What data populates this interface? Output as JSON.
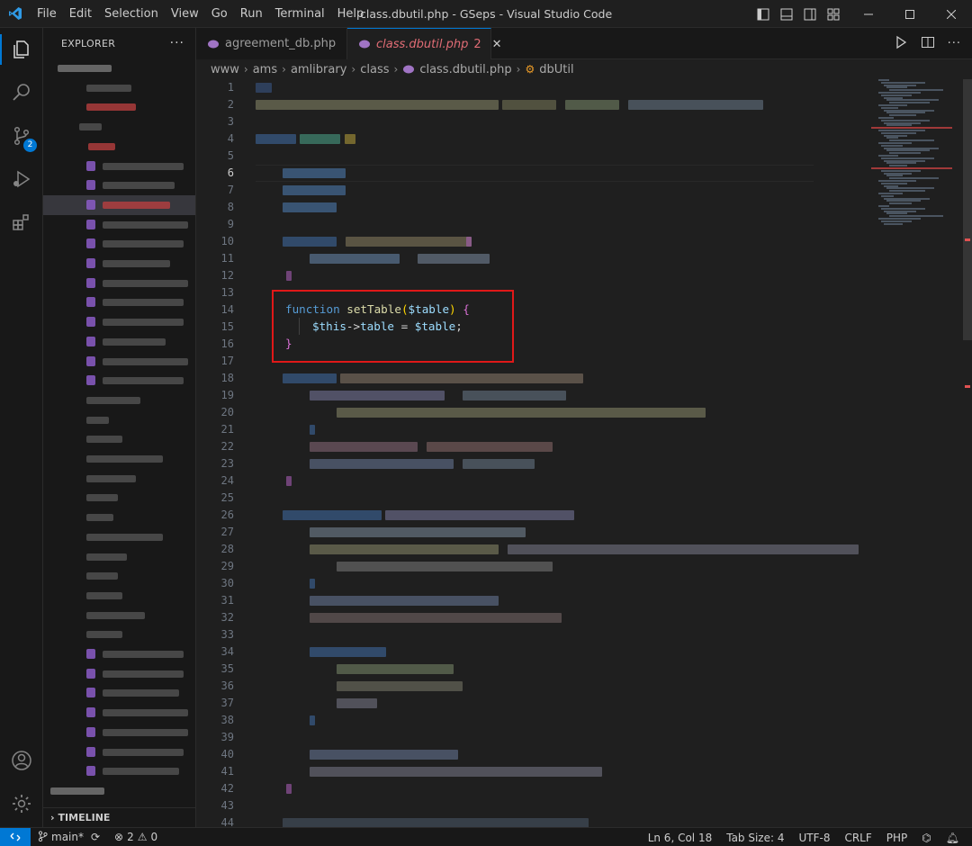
{
  "titlebar": {
    "menu": [
      "File",
      "Edit",
      "Selection",
      "View",
      "Go",
      "Run",
      "Terminal",
      "Help"
    ],
    "title": "class.dbutil.php - GSeps - Visual Studio Code"
  },
  "activity": {
    "icons": [
      "explorer-icon",
      "search-icon",
      "source-control-icon",
      "run-debug-icon",
      "extensions-icon",
      "accounts-icon",
      "manage-gear-icon"
    ],
    "source_control_badge": "2"
  },
  "explorer": {
    "header": "EXPLORER",
    "more": "···",
    "timeline": "TIMELINE"
  },
  "tabs": [
    {
      "label": "agreement_db.php",
      "active": false
    },
    {
      "label": "class.dbutil.php",
      "active": true,
      "problems": "2"
    }
  ],
  "breadcrumb": [
    "www",
    "ams",
    "amlibrary",
    "class",
    "class.dbutil.php",
    "dbUtil"
  ],
  "editor": {
    "line_numbers": [
      "1",
      "2",
      "3",
      "4",
      "5",
      "6",
      "7",
      "8",
      "9",
      "10",
      "11",
      "12",
      "13",
      "14",
      "15",
      "16",
      "17",
      "18",
      "19",
      "20",
      "21",
      "22",
      "23",
      "24",
      "25",
      "26",
      "27",
      "28",
      "29",
      "30",
      "31",
      "32",
      "33",
      "34",
      "35",
      "36",
      "37",
      "38",
      "39",
      "40",
      "41",
      "42",
      "43",
      "44"
    ],
    "current_line": "6",
    "highlighted_code": {
      "line14": {
        "kw": "function",
        "name": "setTable",
        "open": "(",
        "param": "$table",
        "close": ")",
        "brace": "{"
      },
      "line15": {
        "this": "$this",
        "arrow": "->",
        "prop": "table",
        "eq": " = ",
        "val": "$table",
        "semi": ";"
      },
      "line16": {
        "brace": "}"
      }
    }
  },
  "statusbar": {
    "branch": "main*",
    "errors": "2",
    "warnings": "0",
    "position": "Ln 6, Col 18",
    "tab_size": "Tab Size: 4",
    "encoding": "UTF-8",
    "eol": "CRLF",
    "language": "PHP"
  },
  "colors": {
    "accent": "#0078d4",
    "keyword": "#569cd6",
    "function": "#dcdcaa",
    "variable": "#9cdcfe",
    "highlight_box": "#e01818"
  }
}
